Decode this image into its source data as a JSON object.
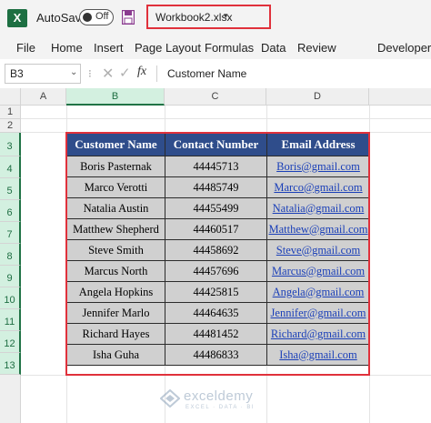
{
  "titlebar": {
    "app_logo": "X",
    "autosave_label": "AutoSave",
    "autosave_state": "Off",
    "filename": "Workbook2.xlsx",
    "file_caret": "▾"
  },
  "ribbon": {
    "tabs": [
      "File",
      "Home",
      "Insert",
      "Page Layout",
      "Formulas",
      "Data",
      "Review",
      "Developer"
    ]
  },
  "formula_bar": {
    "name_box": "B3",
    "name_caret": "⌄",
    "separator": "⁝",
    "cancel_glyph": "✕",
    "enter_glyph": "✓",
    "fx_label": "fx",
    "content": "Customer Name"
  },
  "grid": {
    "columns": [
      "A",
      "B",
      "C",
      "D"
    ],
    "rows": [
      "1",
      "2",
      "3",
      "4",
      "5",
      "6",
      "7",
      "8",
      "9",
      "10",
      "11",
      "12",
      "13"
    ],
    "selected_column": "B",
    "selected_rows": [
      "3",
      "4",
      "5",
      "6",
      "7",
      "8",
      "9",
      "10",
      "11",
      "12",
      "13"
    ]
  },
  "table": {
    "headers": [
      "Customer Name",
      "Contact Number",
      "Email Address"
    ],
    "rows": [
      [
        "Boris Pasternak",
        "44445713",
        "Boris@gmail.com"
      ],
      [
        "Marco Verotti",
        "44485749",
        "Marco@gmail.com"
      ],
      [
        "Natalia Austin",
        "44455499",
        "Natalia@gmail.com"
      ],
      [
        "Matthew Shepherd",
        "44460517",
        "Matthew@gmail.com"
      ],
      [
        "Steve Smith",
        "44458692",
        "Steve@gmail.com"
      ],
      [
        "Marcus North",
        "44457696",
        "Marcus@gmail.com"
      ],
      [
        "Angela Hopkins",
        "44425815",
        "Angela@gmail.com"
      ],
      [
        "Jennifer Marlo",
        "44464635",
        "Jennifer@gmail.com"
      ],
      [
        "Richard Hayes",
        "44481452",
        "Richard@gmail.com"
      ],
      [
        "Isha Guha",
        "44486833",
        "Isha@gmail.com"
      ]
    ]
  },
  "watermark": {
    "name": "exceldemy",
    "tagline": "EXCEL · DATA · BI"
  },
  "colors": {
    "header_fill": "#2f4d8b",
    "cell_fill": "#d0d0d0",
    "highlight_border": "#e0313b",
    "excel_green": "#217346"
  }
}
